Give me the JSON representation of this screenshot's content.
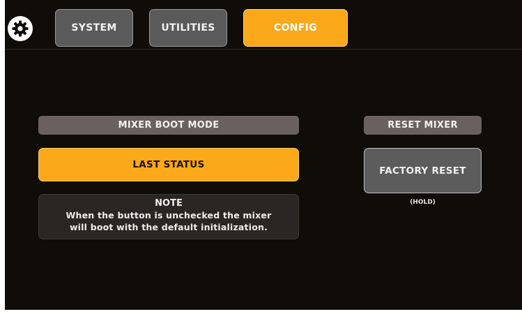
{
  "header": {
    "tabs": [
      {
        "label": "SYSTEM",
        "active": false
      },
      {
        "label": "UTILITIES",
        "active": false
      },
      {
        "label": "CONFIG",
        "active": true
      }
    ],
    "settings_icon": "gear-icon"
  },
  "boot_mode": {
    "title": "MIXER BOOT MODE",
    "button_label": "LAST STATUS",
    "note_title": "NOTE",
    "note_line1": "When the button is unchecked the mixer",
    "note_line2": "will boot with the default initialization."
  },
  "reset": {
    "title": "RESET MIXER",
    "button_label": "FACTORY RESET",
    "hint": "(HOLD)"
  },
  "colors": {
    "background": "#100c08",
    "accent": "#fba81a",
    "tab_gray": "#5a5a5a",
    "label_bar": "#6a615e"
  }
}
